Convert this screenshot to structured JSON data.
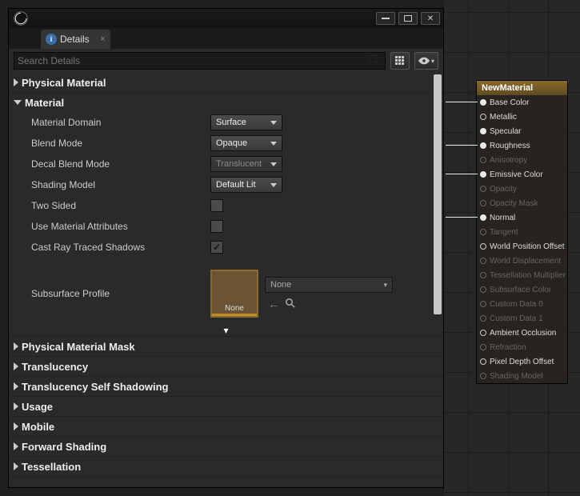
{
  "tab": {
    "label": "Details"
  },
  "search": {
    "placeholder": "Search Details"
  },
  "categories": {
    "physical_material": "Physical Material",
    "material": "Material",
    "physical_material_mask": "Physical Material Mask",
    "translucency": "Translucency",
    "translucency_self_shadowing": "Translucency Self Shadowing",
    "usage": "Usage",
    "mobile": "Mobile",
    "forward_shading": "Forward Shading",
    "tessellation": "Tessellation"
  },
  "material": {
    "domain_label": "Material Domain",
    "domain_value": "Surface",
    "blend_label": "Blend Mode",
    "blend_value": "Opaque",
    "decal_label": "Decal Blend Mode",
    "decal_value": "Translucent",
    "shading_label": "Shading Model",
    "shading_value": "Default Lit",
    "two_sided_label": "Two Sided",
    "two_sided_checked": false,
    "use_attrs_label": "Use Material Attributes",
    "use_attrs_checked": false,
    "cast_rt_label": "Cast Ray Traced Shadows",
    "cast_rt_checked": true,
    "ssp_label": "Subsurface Profile",
    "ssp_swatch": "None",
    "ssp_value": "None"
  },
  "node": {
    "title": "NewMaterial",
    "pins": [
      {
        "label": "Base Color",
        "active": true,
        "shape": "dot",
        "w": true
      },
      {
        "label": "Metallic",
        "active": true,
        "shape": "ring"
      },
      {
        "label": "Specular",
        "active": true,
        "shape": "dot"
      },
      {
        "label": "Roughness",
        "active": true,
        "shape": "dot",
        "w": true
      },
      {
        "label": "Anisotropy",
        "active": false,
        "shape": "ring"
      },
      {
        "label": "Emissive Color",
        "active": true,
        "shape": "dot",
        "w": true
      },
      {
        "label": "Opacity",
        "active": false,
        "shape": "ring"
      },
      {
        "label": "Opacity Mask",
        "active": false,
        "shape": "ring"
      },
      {
        "label": "Normal",
        "active": true,
        "shape": "dot",
        "w": true
      },
      {
        "label": "Tangent",
        "active": false,
        "shape": "ring"
      },
      {
        "label": "World Position Offset",
        "active": true,
        "shape": "ring"
      },
      {
        "label": "World Displacement",
        "active": false,
        "shape": "ring"
      },
      {
        "label": "Tessellation Multiplier",
        "active": false,
        "shape": "ring"
      },
      {
        "label": "Subsurface Color",
        "active": false,
        "shape": "ring"
      },
      {
        "label": "Custom Data 0",
        "active": false,
        "shape": "ring"
      },
      {
        "label": "Custom Data 1",
        "active": false,
        "shape": "ring"
      },
      {
        "label": "Ambient Occlusion",
        "active": true,
        "shape": "ring"
      },
      {
        "label": "Refraction",
        "active": false,
        "shape": "ring"
      },
      {
        "label": "Pixel Depth Offset",
        "active": true,
        "shape": "ring"
      },
      {
        "label": "Shading Model",
        "active": false,
        "shape": "ring"
      }
    ]
  }
}
